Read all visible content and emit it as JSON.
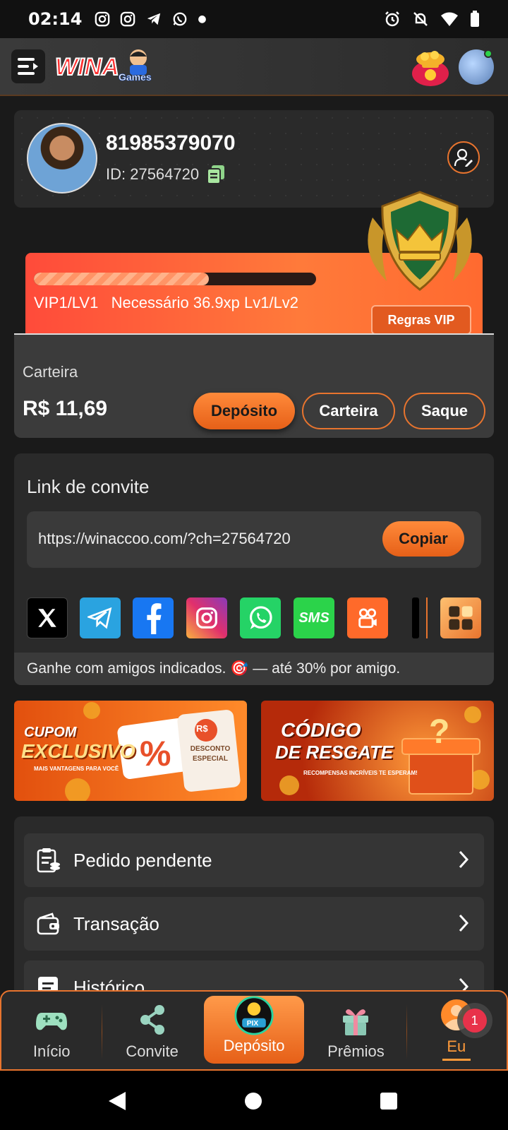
{
  "status_bar": {
    "time": "02:14"
  },
  "header": {
    "logo_text": "WINA",
    "logo_sub": "Games"
  },
  "profile": {
    "phone": "81985379070",
    "id_text": "ID: 27564720"
  },
  "vip": {
    "progress_fraction": 0.62,
    "level": "VIP1/LV1",
    "requirement": "Necessário 36.9xp Lv1/Lv2",
    "rules_button": "Regras VIP"
  },
  "wallet": {
    "label": "Carteira",
    "balance": "R$ 11,69",
    "deposit_button": "Depósito",
    "wallet_button": "Carteira",
    "withdraw_button": "Saque"
  },
  "invite": {
    "title": "Link de convite",
    "url": "https://winaccoo.com/?ch=27564720",
    "copy_button": "Copiar",
    "footer": "Ganhe com amigos indicados. 🎯 — até 30% por amigo.",
    "share_icons": [
      {
        "name": "x-icon",
        "color": "#000000",
        "glyph": "𝕏"
      },
      {
        "name": "telegram-icon",
        "color": "#2aa3e0",
        "glyph": ""
      },
      {
        "name": "facebook-icon",
        "color": "#1877f2",
        "glyph": "f"
      },
      {
        "name": "instagram-icon",
        "color": "#e1306c",
        "glyph": ""
      },
      {
        "name": "whatsapp-icon",
        "color": "#25d366",
        "glyph": ""
      },
      {
        "name": "sms-icon",
        "color": "#2bd34a",
        "glyph": "SMS"
      },
      {
        "name": "kwai-icon",
        "color": "#ff6a2a",
        "glyph": ""
      }
    ]
  },
  "promos": {
    "coupon_title_1": "CUPOM",
    "coupon_title_2": "EXCLUSIVO",
    "coupon_sub": "MAIS VANTAGENS PARA VOCÊ",
    "coupon_percent": "%",
    "coupon_ticket_rs": "R$",
    "coupon_ticket_text": "DESCONTO ESPECIAL",
    "code_title_1": "CÓDIGO",
    "code_title_2": "DE RESGATE",
    "code_sub": "RECOMPENSAS INCRÍVEIS TE ESPERAM!"
  },
  "menu": {
    "items": [
      {
        "label": "Pedido pendente"
      },
      {
        "label": "Transação"
      },
      {
        "label": "Histórico"
      }
    ]
  },
  "bottom_nav": {
    "items": [
      {
        "label": "Início"
      },
      {
        "label": "Convite"
      },
      {
        "label": "Depósito"
      },
      {
        "label": "Prêmios"
      },
      {
        "label": "Eu"
      }
    ],
    "deposit_icon_text": "PIX",
    "badge_count": "1"
  },
  "colors": {
    "accent": "#e8742e",
    "vip_gradient_start": "#ff4b3a",
    "panel": "#2a2a2a"
  }
}
